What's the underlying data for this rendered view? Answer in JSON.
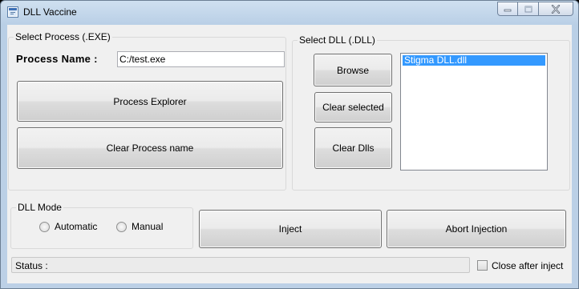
{
  "window": {
    "title": "DLL Vaccine",
    "icons": {
      "app": "app-icon",
      "minimize": "minimize-icon",
      "maximize": "maximize-icon",
      "close": "close-icon"
    }
  },
  "select_process": {
    "group_title": "Select Process (.EXE)",
    "process_name_label": "Process Name :",
    "process_name_value": "C:/test.exe",
    "process_explorer_label": "Process Explorer",
    "clear_process_label": "Clear Process name"
  },
  "select_dll": {
    "group_title": "Select DLL (.DLL)",
    "browse_label": "Browse",
    "clear_selected_label": "Clear selected",
    "clear_dlls_label": "Clear Dlls",
    "dll_list": [
      "Stigma DLL.dll"
    ],
    "selected_index": 0,
    "selection_color": "#3399ff"
  },
  "dll_mode": {
    "group_title": "DLL Mode",
    "options": [
      "Automatic",
      "Manual"
    ],
    "selected": null
  },
  "actions": {
    "inject_label": "Inject",
    "abort_label": "Abort Injection"
  },
  "status": {
    "label": "Status :",
    "close_after_inject_label": "Close after inject",
    "close_after_inject_checked": false
  }
}
